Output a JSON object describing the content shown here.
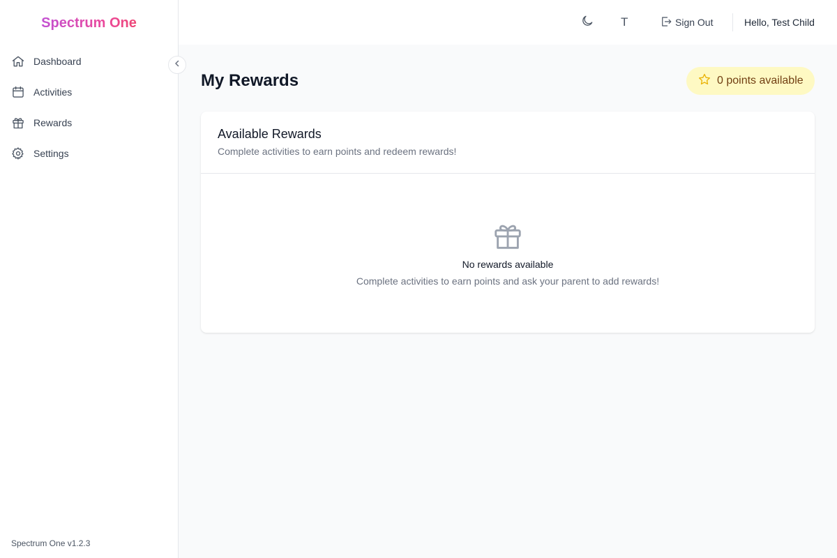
{
  "app": {
    "brand": "Spectrum One",
    "version": "Spectrum One v1.2.3",
    "brand_gradient": [
      "#a855f7",
      "#ec4899",
      "#ef4444"
    ]
  },
  "sidebar": {
    "items": [
      {
        "label": "Dashboard",
        "icon": "home-icon"
      },
      {
        "label": "Activities",
        "icon": "calendar-icon"
      },
      {
        "label": "Rewards",
        "icon": "gift-icon"
      },
      {
        "label": "Settings",
        "icon": "gear-icon"
      }
    ],
    "collapse_icon": "chevron-left-icon"
  },
  "header": {
    "theme_icon": "moon-icon",
    "font_toggle": "T",
    "signout_label": "Sign Out",
    "signout_icon": "sign-out-icon",
    "greeting": "Hello, Test Child"
  },
  "main": {
    "title": "My Rewards",
    "points": {
      "text": "0 points available",
      "icon": "star-icon",
      "value": 0,
      "color": "#fef9c3"
    },
    "card": {
      "title": "Available Rewards",
      "description": "Complete activities to earn points and redeem rewards!",
      "empty": {
        "icon": "gift-icon",
        "title": "No rewards available",
        "description": "Complete activities to earn points and ask your parent to add rewards!"
      }
    }
  }
}
